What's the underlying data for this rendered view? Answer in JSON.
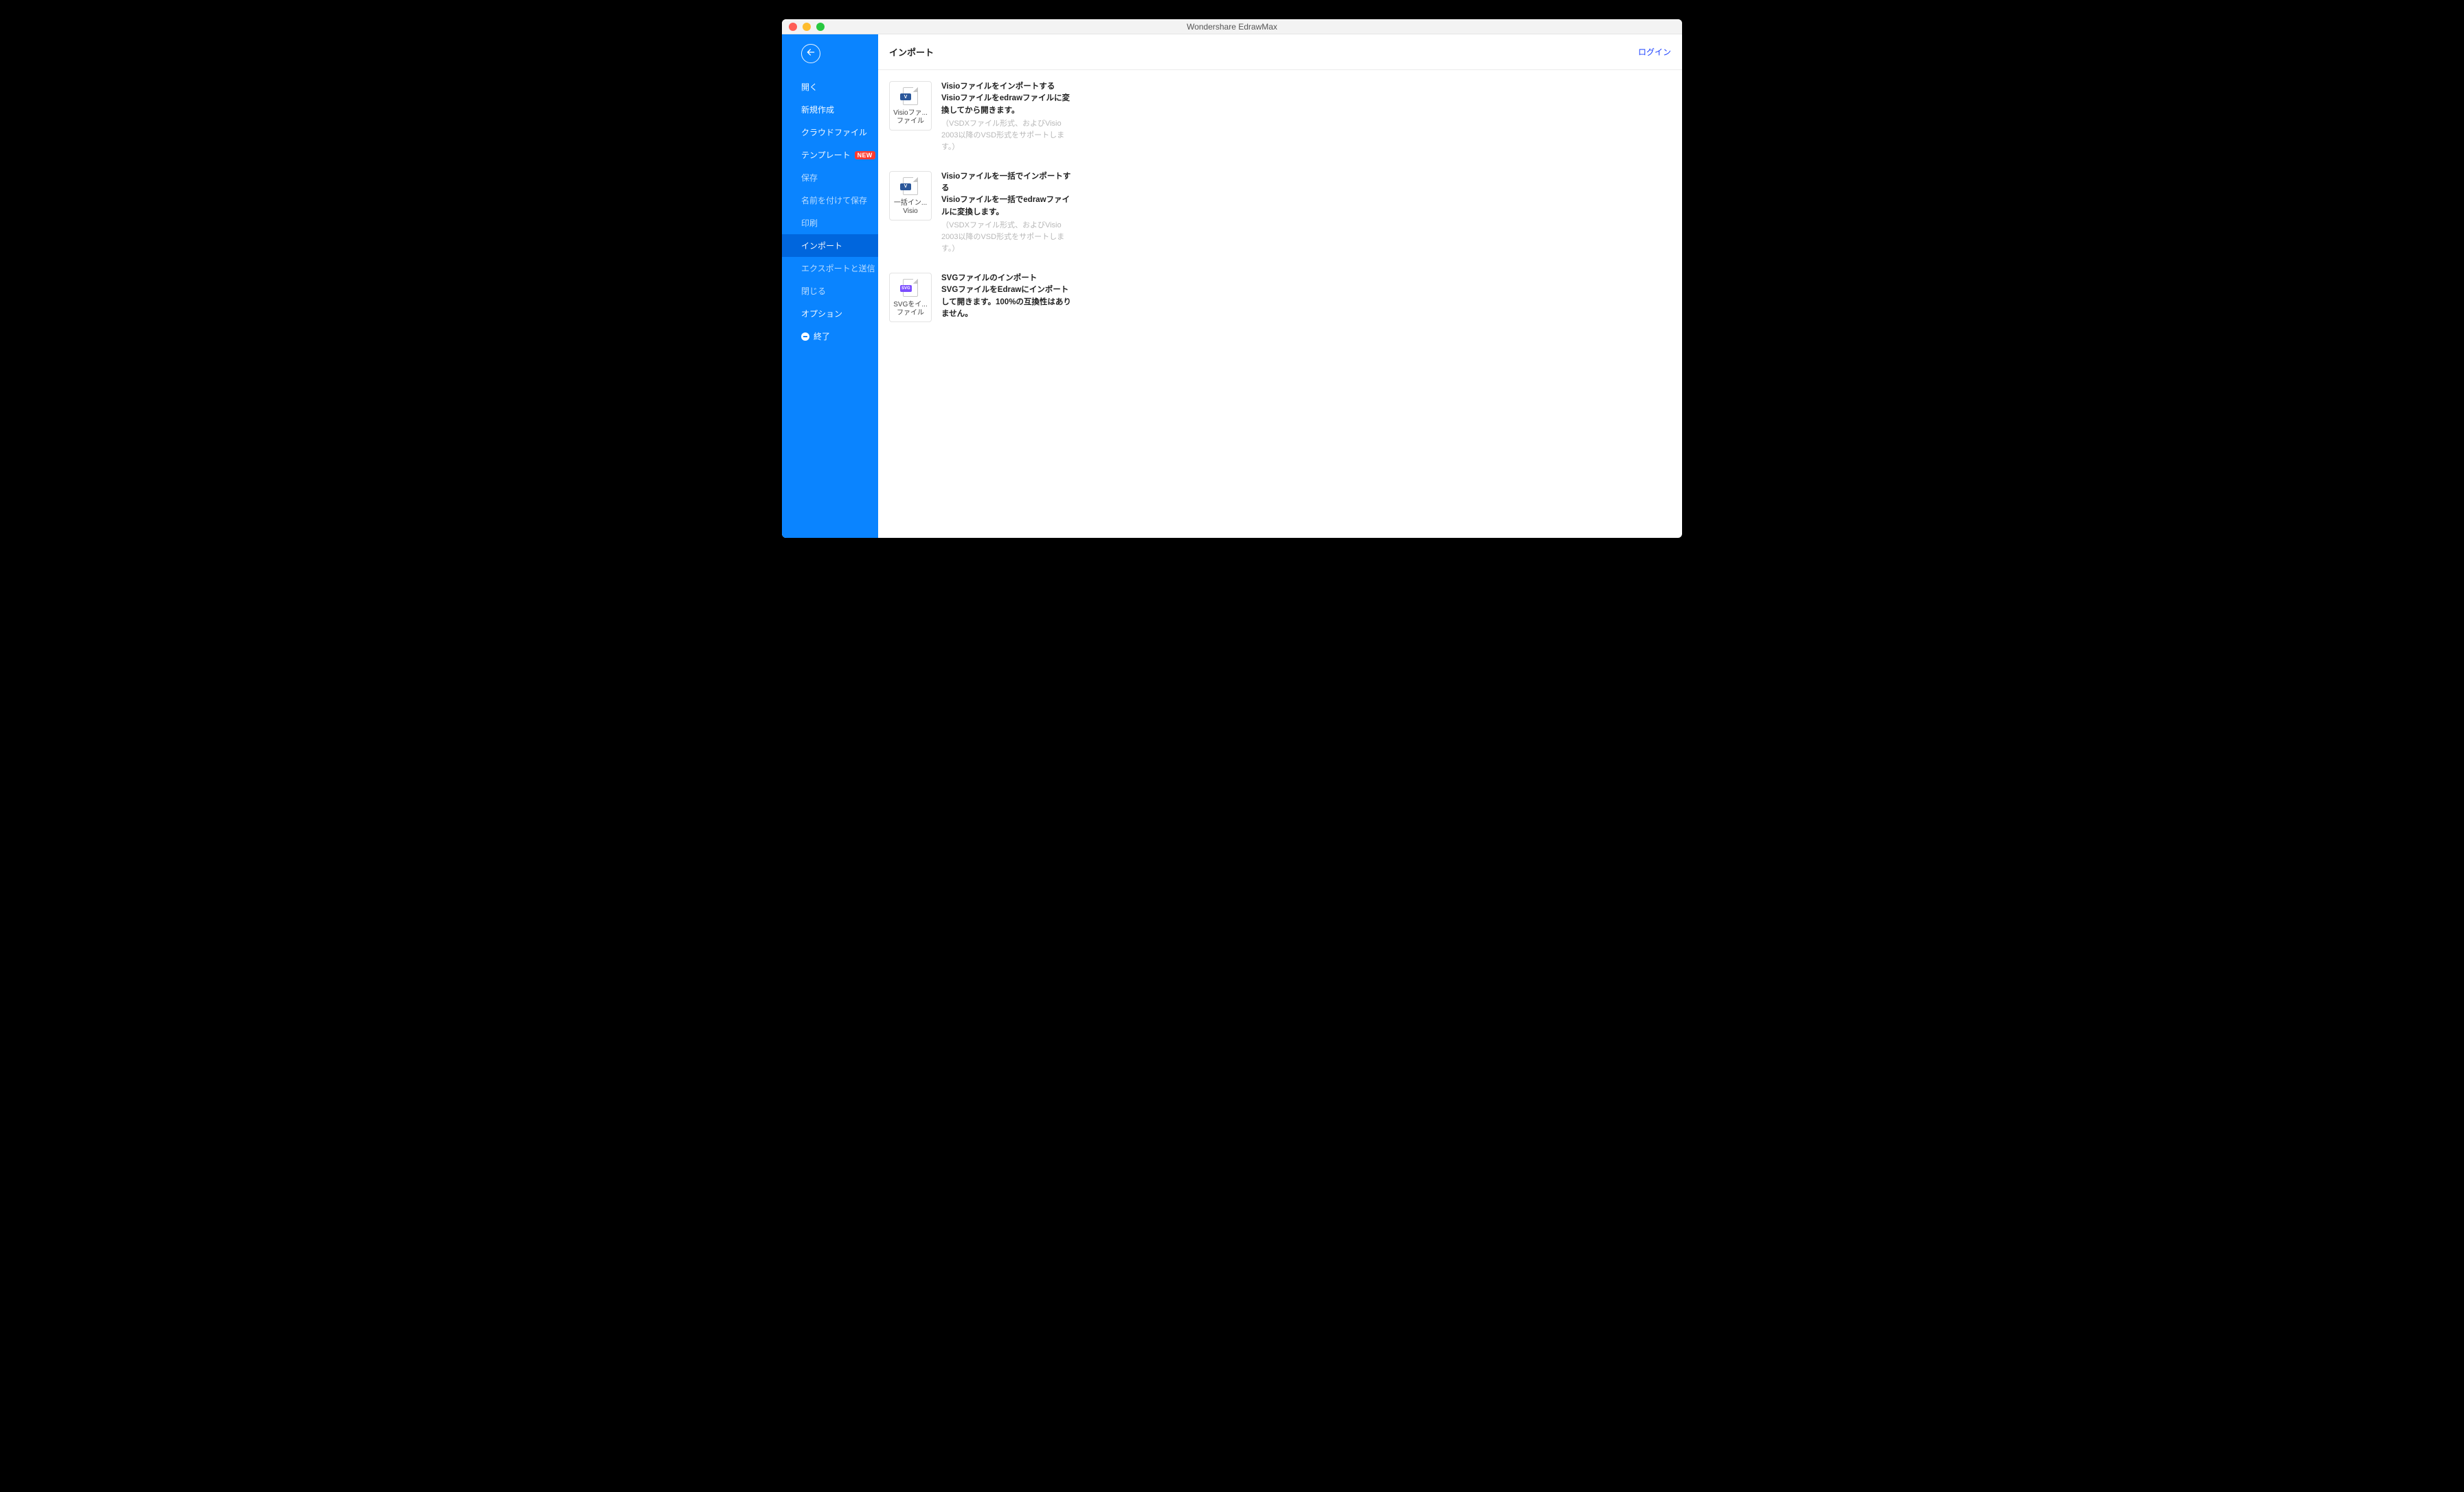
{
  "titlebar": {
    "title": "Wondershare EdrawMax"
  },
  "sidebar": {
    "items": [
      {
        "label": "開く",
        "dim": false
      },
      {
        "label": "新規作成",
        "dim": false
      },
      {
        "label": "クラウドファイル",
        "dim": false
      },
      {
        "label": "テンプレート",
        "dim": false,
        "badge": "NEW"
      },
      {
        "label": "保存",
        "dim": true
      },
      {
        "label": "名前を付けて保存",
        "dim": true
      },
      {
        "label": "印刷",
        "dim": true
      },
      {
        "label": "インポート",
        "dim": false,
        "active": true
      },
      {
        "label": "エクスポートと送信",
        "dim": true
      },
      {
        "label": "閉じる",
        "dim": true
      },
      {
        "label": "オプション",
        "dim": false
      },
      {
        "label": "終了",
        "dim": false,
        "icon": "exit"
      }
    ]
  },
  "header": {
    "page_title": "インポート",
    "login": "ログイン"
  },
  "imports": [
    {
      "card_label_l1": "Visioファ...",
      "card_label_l2": "ファイル",
      "icon_badge": "V",
      "icon_type": "visio",
      "title": "Visioファイルをインポートする",
      "sub": "Visioファイルをedrawファイルに変換してから開きます。",
      "note": "（VSDXファイル形式、およびVisio 2003以降のVSD形式をサポートします。）"
    },
    {
      "card_label_l1": "一括イン...",
      "card_label_l2": "Visio",
      "icon_badge": "V",
      "icon_type": "visio",
      "title": "Visioファイルを一括でインポートする",
      "sub": "Visioファイルを一括でedrawファイルに変換します。",
      "note": "（VSDXファイル形式、およびVisio 2003以降のVSD形式をサポートします。）"
    },
    {
      "card_label_l1": "SVGをイ...",
      "card_label_l2": "ファイル",
      "icon_badge": "SVG",
      "icon_type": "svg",
      "title": "SVGファイルのインポート",
      "sub": "SVGファイルをEdrawにインポートして開きます。100%の互換性はありません。",
      "note": ""
    }
  ]
}
